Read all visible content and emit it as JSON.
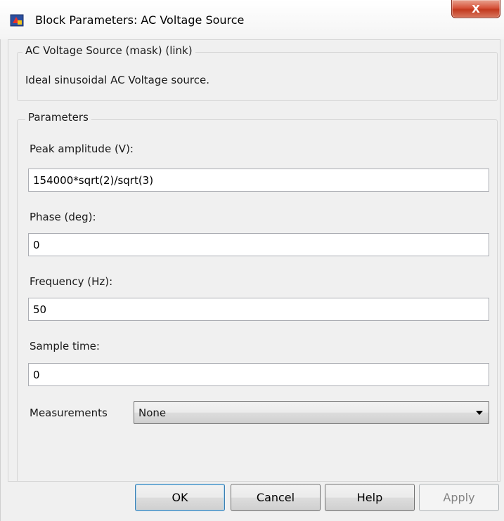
{
  "window": {
    "title": "Block Parameters: AC Voltage Source",
    "close_label": "X"
  },
  "mask": {
    "title": "AC Voltage Source (mask) (link)",
    "description": "Ideal sinusoidal AC Voltage source."
  },
  "parameters": {
    "group_title": "Parameters",
    "fields": [
      {
        "label": "Peak amplitude (V):",
        "value": "154000*sqrt(2)/sqrt(3)"
      },
      {
        "label": "Phase (deg):",
        "value": "0"
      },
      {
        "label": "Frequency (Hz):",
        "value": "50"
      },
      {
        "label": "Sample time:",
        "value": "0"
      }
    ],
    "measurements": {
      "label": "Measurements",
      "selected": "None"
    }
  },
  "buttons": {
    "ok": "OK",
    "cancel": "Cancel",
    "help": "Help",
    "apply": "Apply"
  },
  "icons": {
    "app": "simulink-block-icon",
    "close": "close-icon",
    "dropdown": "chevron-down-icon"
  },
  "colors": {
    "close_button": "#c33a1f",
    "background": "#f0f0f0",
    "ok_border": "#3c7fb1"
  }
}
